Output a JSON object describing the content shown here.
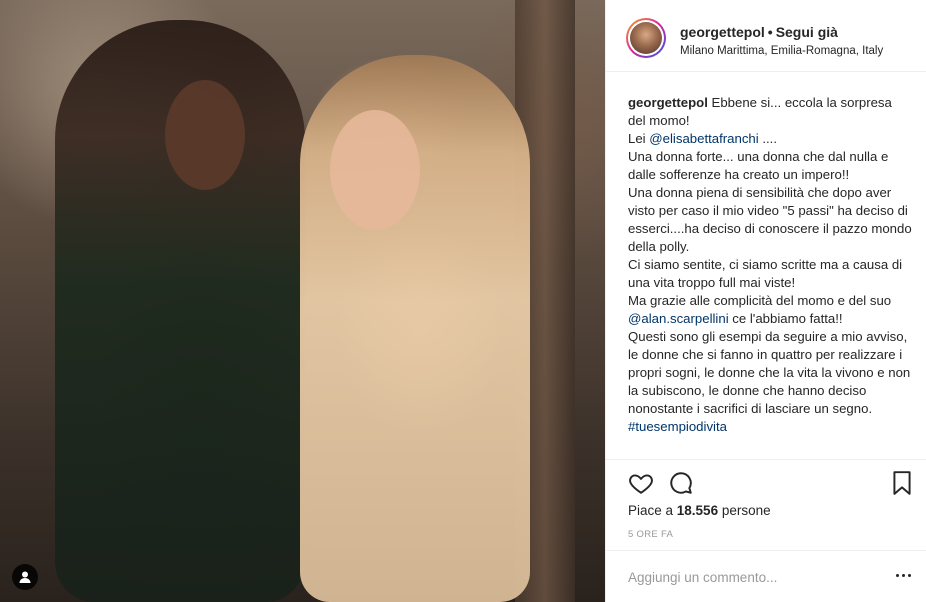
{
  "post": {
    "image_alt": "Two women posing at an outdoor restaurant at night",
    "user_tag_icon": "person-tag-icon"
  },
  "header": {
    "username": "georgettepol",
    "separator": "•",
    "follow_label": "Segui già",
    "location": "Milano Marittima, Emilia-Romagna, Italy"
  },
  "caption": {
    "username": "georgettepol",
    "line1_text": " Ebbene si... eccola la sorpresa del momo!",
    "line2_prefix": "Lei ",
    "mention1": "@elisabettafranchi",
    "line2_suffix": " ....",
    "line3": "Una donna forte... una donna che dal nulla e dalle sofferenze ha creato un impero!!",
    "line4": "Una donna piena di sensibilità che dopo aver visto per caso il mio video \"5 passi\" ha deciso di esserci....ha deciso di conoscere il pazzo mondo della polly.",
    "line5": "Ci siamo sentite, ci siamo scritte ma a causa di una vita troppo full mai viste!",
    "line6_prefix": "Ma grazie alle complicità del momo e del suo ",
    "mention2": "@alan.scarpellini",
    "line6_suffix": " ce l'abbiamo fatta!!",
    "line7": "Questi sono gli esempi da seguire a mio avviso, le donne che si fanno in quattro per realizzare i propri sogni, le donne che la vita la vivono e non la subiscono, le donne che hanno deciso nonostante i sacrifici di lasciare un segno.",
    "hashtag1": "#tuesempiodivita"
  },
  "actions": {
    "like_icon": "heart-icon",
    "comment_icon": "comment-icon",
    "save_icon": "bookmark-icon"
  },
  "likes": {
    "prefix": "Piace a ",
    "count": "18.556",
    "suffix": " persone"
  },
  "time_ago": "5 ORE FA",
  "comment": {
    "placeholder": "Aggiungi un commento...",
    "more_icon": "more-options-icon"
  }
}
